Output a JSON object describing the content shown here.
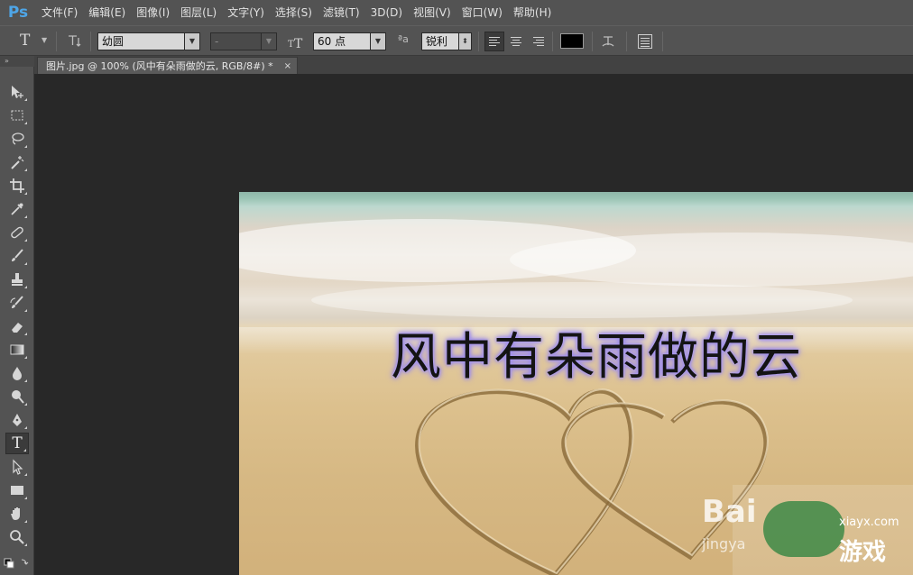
{
  "app": {
    "logo": "Ps"
  },
  "menu": [
    "文件(F)",
    "编辑(E)",
    "图像(I)",
    "图层(L)",
    "文字(Y)",
    "选择(S)",
    "滤镜(T)",
    "3D(D)",
    "视图(V)",
    "窗口(W)",
    "帮助(H)"
  ],
  "options": {
    "tool_glyph": "T",
    "font_family": "幼圆",
    "font_style": "-",
    "font_size": "60 点",
    "aa_label": "ªa",
    "antialias": "锐利",
    "text_color": "#000000"
  },
  "tabs": [
    {
      "label": "图片.jpg @ 100% (风中有朵雨做的云, RGB/8#) *",
      "close": "×"
    }
  ],
  "canvas": {
    "text_layer": "风中有朵雨做的云"
  },
  "watermark": {
    "baidu": "Bai",
    "baidu_sub": "jingya",
    "site": "xiayx.com",
    "game": "游戏"
  },
  "tools": [
    "move-tool-icon",
    "marquee-tool-icon",
    "lasso-tool-icon",
    "magic-wand-icon",
    "crop-tool-icon",
    "eyedropper-icon",
    "healing-brush-icon",
    "brush-tool-icon",
    "clone-stamp-icon",
    "history-brush-icon",
    "eraser-icon",
    "gradient-tool-icon",
    "blur-tool-icon",
    "dodge-tool-icon",
    "pen-tool-icon",
    "type-tool-icon",
    "path-selection-icon",
    "rectangle-tool-icon",
    "hand-tool-icon",
    "zoom-tool-icon"
  ]
}
